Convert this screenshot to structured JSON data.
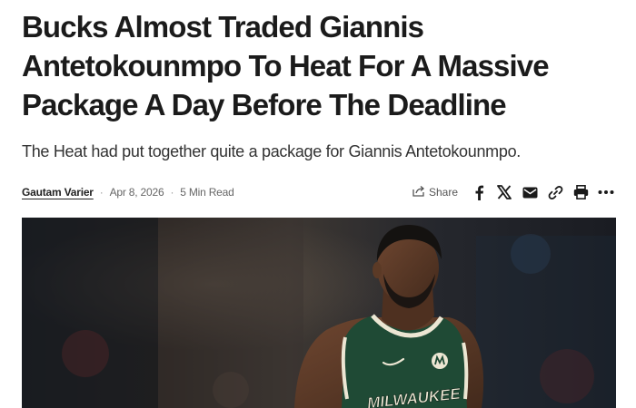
{
  "article": {
    "headline": "Bucks Almost Traded Giannis Antetokounmpo To Heat For A Massive Package A Day Before The Deadline",
    "subheadline": "The Heat had put together quite a package for Giannis Antetokounmpo.",
    "author": "Gautam Varier",
    "date": "Apr 8, 2026",
    "read_time": "5 Min Read",
    "separator": "·"
  },
  "share": {
    "label": "Share",
    "icons": [
      "share-icon",
      "facebook-icon",
      "x-icon",
      "email-icon",
      "link-icon",
      "print-icon",
      "more-icon"
    ]
  },
  "hero_image": {
    "jersey_text": "MILWAUKEE",
    "colors": {
      "jersey": "#1f4a35",
      "jersey_trim": "#ece6d3",
      "skin": "#5b3a26",
      "background": "#1e2026"
    }
  }
}
